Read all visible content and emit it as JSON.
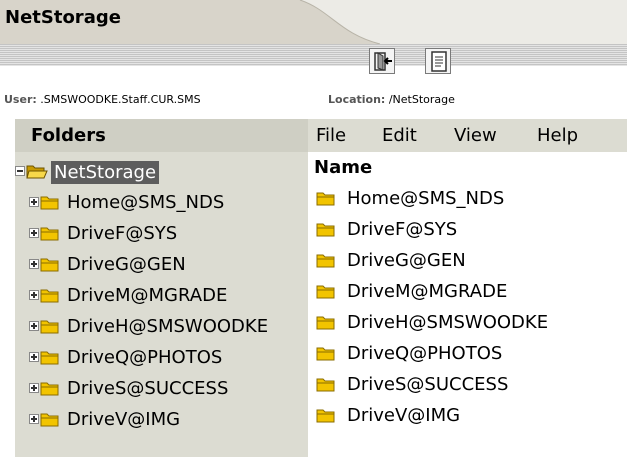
{
  "app": {
    "title": "NetStorage"
  },
  "toolbar": {
    "buttons": [
      {
        "name": "logout-button",
        "icon": "logout-icon"
      },
      {
        "name": "document-button",
        "icon": "document-icon"
      }
    ]
  },
  "info": {
    "user_label": "User:",
    "user_value": ".SMSWOODKE.Staff.CUR.SMS",
    "location_label": "Location:",
    "location_value": "/NetStorage"
  },
  "folders": {
    "header": "Folders",
    "root": {
      "label": "NetStorage",
      "expanded": true,
      "selected": true
    },
    "items": [
      {
        "label": "Home@SMS_NDS"
      },
      {
        "label": "DriveF@SYS"
      },
      {
        "label": "DriveG@GEN"
      },
      {
        "label": "DriveM@MGRADE"
      },
      {
        "label": "DriveH@SMSWOODKE"
      },
      {
        "label": "DriveQ@PHOTOS"
      },
      {
        "label": "DriveS@SUCCESS"
      },
      {
        "label": "DriveV@IMG"
      }
    ]
  },
  "menu": {
    "items": [
      {
        "label": "File"
      },
      {
        "label": "Edit"
      },
      {
        "label": "View"
      },
      {
        "label": "Help"
      }
    ]
  },
  "content": {
    "column_header": "Name",
    "items": [
      {
        "label": "Home@SMS_NDS"
      },
      {
        "label": "DriveF@SYS"
      },
      {
        "label": "DriveG@GEN"
      },
      {
        "label": "DriveM@MGRADE"
      },
      {
        "label": "DriveH@SMSWOODKE"
      },
      {
        "label": "DriveQ@PHOTOS"
      },
      {
        "label": "DriveS@SUCCESS"
      },
      {
        "label": "DriveV@IMG"
      }
    ]
  },
  "colors": {
    "panel_bg": "#dcdcd2",
    "selected_bg": "#5d5d5d",
    "folder_yellow": "#f2c400"
  }
}
